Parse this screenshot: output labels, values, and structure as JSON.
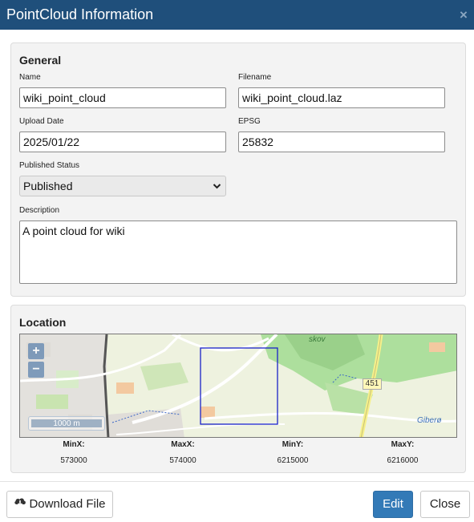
{
  "dialog": {
    "title": "PointCloud Information",
    "close_glyph": "×"
  },
  "general": {
    "heading": "General",
    "name_label": "Name",
    "name_value": "wiki_point_cloud",
    "filename_label": "Filename",
    "filename_value": "wiki_point_cloud.laz",
    "upload_label": "Upload Date",
    "upload_value": "2025/01/22",
    "epsg_label": "EPSG",
    "epsg_value": "25832",
    "status_label": "Published Status",
    "status_value": "Published",
    "description_label": "Description",
    "description_value": "A point cloud for wiki"
  },
  "location": {
    "heading": "Location",
    "zoom_in": "+",
    "zoom_out": "−",
    "scale_label": "1000 m",
    "map_labels": {
      "road_number": "451",
      "place_skov": "skov",
      "place_gibera": "Giberø"
    },
    "bounds": {
      "minx_label": "MinX:",
      "minx": "573000",
      "maxx_label": "MaxX:",
      "maxx": "574000",
      "miny_label": "MinY:",
      "miny": "6215000",
      "maxy_label": "MaxY:",
      "maxy": "6216000"
    }
  },
  "footer": {
    "download_label": "Download File",
    "edit_label": "Edit",
    "close_label": "Close"
  },
  "icons": {
    "download": "cloud-download-icon",
    "close": "close-icon",
    "dropdown": "chevron-down-icon"
  },
  "colors": {
    "titlebar": "#1f4f7b",
    "primary": "#337ab7",
    "extent_box": "#1a22c9"
  }
}
